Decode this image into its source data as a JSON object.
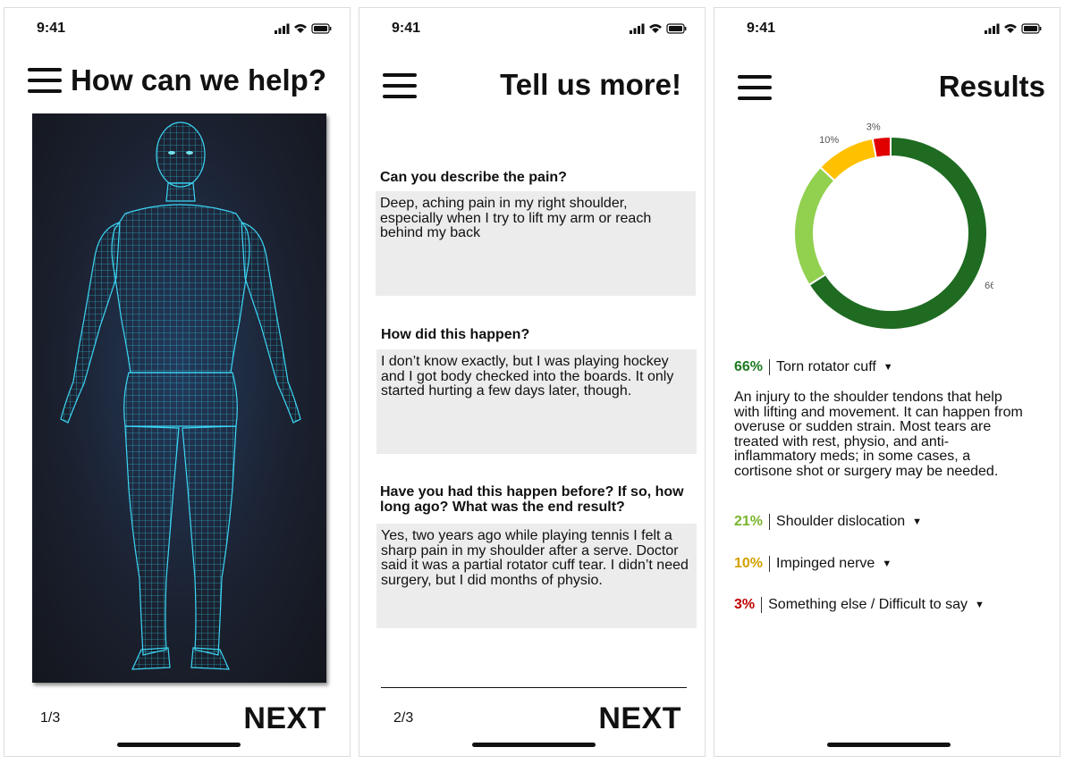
{
  "status": {
    "time": "9:41"
  },
  "screen1": {
    "title": "How can we help?",
    "page": "1/3",
    "next": "NEXT"
  },
  "screen2": {
    "title": "Tell us more!",
    "questions": [
      {
        "q": "Can you describe the pain?",
        "a": "Deep, aching pain in my right shoulder, especially when I try to lift my arm or reach behind my back"
      },
      {
        "q": "How did this happen?",
        "a": "I don’t know exactly, but I was playing hockey and I got body checked into the boards. It only started hurting a few days later, though."
      },
      {
        "q": "Have you had this happen before? If so, how long ago? What was the end result?",
        "a": "Yes,  two years ago while playing tennis I felt a sharp pain in my shoulder after a serve. Doctor said it was a partial rotator cuff tear. I didn’t need surgery, but I did months of physio."
      }
    ],
    "page": "2/3",
    "next": "NEXT"
  },
  "screen3": {
    "title": "Results",
    "chart_data": {
      "type": "pie",
      "categories": [
        "Torn rotator cuff",
        "Shoulder dislocation",
        "Impinged nerve",
        "Something else / Difficult to say"
      ],
      "values": [
        66,
        21,
        10,
        3
      ],
      "labels": [
        "66%",
        "21%",
        "10%",
        "3%"
      ],
      "colors": [
        "#1e6b21",
        "#92d050",
        "#ffc000",
        "#e00000"
      ]
    },
    "results": [
      {
        "pct": "66%",
        "name": "Torn rotator cuff",
        "color": "#1e7a22"
      },
      {
        "pct": "21%",
        "name": "Shoulder dislocation",
        "color": "#7ab52c"
      },
      {
        "pct": "10%",
        "name": "Impinged nerve",
        "color": "#d4a000"
      },
      {
        "pct": "3%",
        "name": "Something else / Difficult to say",
        "color": "#c00000"
      }
    ],
    "description": "An injury to the shoulder tendons that help with lifting and movement. It can happen from overuse or sudden strain. Most tears are treated with rest, physio, and anti-inflammatory meds; in some cases, a cortisone shot or surgery may be needed."
  }
}
